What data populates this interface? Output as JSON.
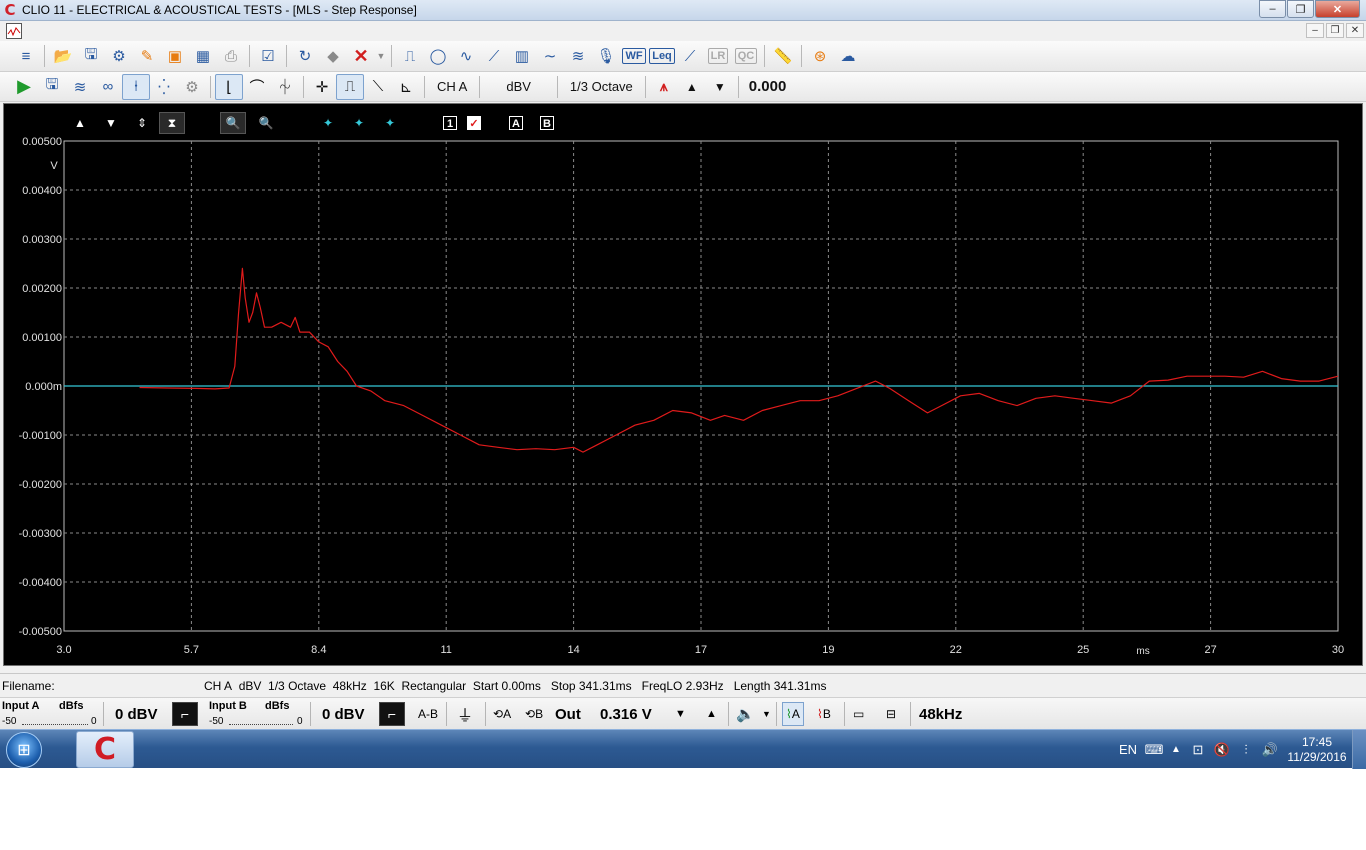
{
  "window": {
    "title": "CLIO 11 - ELECTRICAL & ACOUSTICAL TESTS - [MLS - Step Response]",
    "app_logo": "C",
    "minimize": "‒",
    "maximize": "❐",
    "close": "✕"
  },
  "mdi": {
    "minimize": "‒",
    "restore": "❐",
    "close": "✕"
  },
  "toolbar2": {
    "channel": "CH A",
    "units": "dBV",
    "smoothing": "1/3 Octave",
    "value": "0.000"
  },
  "graph_toolbar": {
    "box_1": "1",
    "check": "✓",
    "box_a": "A",
    "box_b": "B"
  },
  "chart_data": {
    "type": "line",
    "title": "",
    "xlabel": "ms",
    "ylabel": "V",
    "xlim": [
      3.0,
      30
    ],
    "ylim": [
      -0.005,
      0.005
    ],
    "x_tick_labels": [
      "3.0",
      "5.7",
      "8.4",
      "11",
      "14",
      "17",
      "19",
      "22",
      "25",
      "27",
      "30"
    ],
    "y_tick_labels": [
      "0.00500",
      "0.00400",
      "0.00300",
      "0.00200",
      "0.00100",
      "0.000m",
      "-0.00100",
      "-0.00200",
      "-0.00300",
      "-0.00400",
      "-0.00500"
    ],
    "grid": true,
    "background": "#000000",
    "series": [
      {
        "color": "#e01b1b",
        "x": [
          4.6,
          5.2,
          5.8,
          6.2,
          6.5,
          6.62,
          6.7,
          6.78,
          6.84,
          6.92,
          7.0,
          7.08,
          7.16,
          7.25,
          7.4,
          7.6,
          7.8,
          7.9,
          8.0,
          8.2,
          8.4,
          8.6,
          8.8,
          9.0,
          9.2,
          9.5,
          9.8,
          10.2,
          10.6,
          11.0,
          11.4,
          11.8,
          12.2,
          12.6,
          13.0,
          13.4,
          13.8,
          14.0,
          14.3,
          14.7,
          15.1,
          15.5,
          15.9,
          16.3,
          16.7,
          17.0,
          17.4,
          17.8,
          18.2,
          18.6,
          19.0,
          19.4,
          19.8,
          20.2,
          20.5,
          20.9,
          21.3,
          21.6,
          22.0,
          22.4,
          22.8,
          23.2,
          23.6,
          24.0,
          24.4,
          24.8,
          25.2,
          25.6,
          26.0,
          26.4,
          26.8,
          27.2,
          27.6,
          28.0,
          28.4,
          28.8,
          29.2,
          29.6,
          30.0
        ],
        "y": [
          -3e-05,
          -4e-05,
          -5e-05,
          -6e-05,
          -4e-05,
          0.0004,
          0.0015,
          0.0024,
          0.0018,
          0.0013,
          0.0015,
          0.0019,
          0.0016,
          0.0012,
          0.0012,
          0.0013,
          0.0012,
          0.0014,
          0.0011,
          0.0011,
          0.0009,
          0.0008,
          0.0005,
          0.0003,
          0.0,
          -0.0001,
          -0.0003,
          -0.0004,
          -0.0006,
          -0.0008,
          -0.001,
          -0.0012,
          -0.00125,
          -0.0013,
          -0.00128,
          -0.0013,
          -0.00125,
          -0.00135,
          -0.0012,
          -0.001,
          -0.0008,
          -0.0007,
          -0.0005,
          -0.00055,
          -0.0007,
          -0.0006,
          -0.0007,
          -0.0005,
          -0.0004,
          -0.0003,
          -0.0003,
          -0.0002,
          -5e-05,
          0.0001,
          -5e-05,
          -0.0003,
          -0.00055,
          -0.0004,
          -0.0002,
          -0.00015,
          -0.0003,
          -0.0004,
          -0.00025,
          -0.0002,
          -0.00025,
          -0.0003,
          -0.00035,
          -0.0002,
          0.0001,
          0.00012,
          0.0002,
          0.0002,
          0.0002,
          0.00018,
          0.0003,
          0.00015,
          0.0001,
          0.0001,
          0.0002
        ]
      },
      {
        "color": "#35c8d8",
        "x": [
          3.0,
          30.0
        ],
        "y": [
          0.0,
          0.0
        ]
      }
    ]
  },
  "status": {
    "filename_label": "Filename:",
    "info": {
      "channel": "CH A",
      "units": "dBV",
      "smoothing": "1/3 Octave",
      "rate": "48kHz",
      "size": "16K",
      "window": "Rectangular",
      "start": "Start 0.00ms",
      "stop": "Stop 341.31ms",
      "freqlo": "FreqLO 2.93Hz",
      "length": "Length 341.31ms"
    }
  },
  "bottom_bar": {
    "input_a_label": "Input A",
    "input_a_unit": "dBfs",
    "input_a_min": "-50",
    "input_a_max": "0",
    "input_a_value": "0 dBV",
    "input_b_label": "Input B",
    "input_b_unit": "dBfs",
    "input_b_min": "-50",
    "input_b_max": "0",
    "input_b_value": "0 dBV",
    "a_minus_b": "A-B",
    "loop_a": "A",
    "loop_b": "B",
    "out_label": "Out",
    "out_value": "0.316 V",
    "gen_a": "A",
    "gen_b": "B",
    "sample_rate": "48kHz"
  },
  "taskbar": {
    "app_label": "C",
    "language": "EN",
    "time": "17:45",
    "date": "11/29/2016"
  }
}
